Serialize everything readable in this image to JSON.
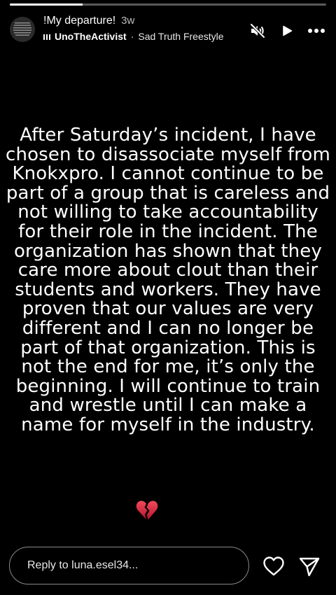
{
  "story": {
    "progress": 0.23,
    "title": "!My departure!",
    "age": "3w",
    "music": {
      "artist": "UnoTheActivist",
      "separator": "·",
      "track": "Sad Truth Freestyle"
    },
    "text_lines": [
      "After Saturday’s incident, I have",
      "chosen to disassociate myself from",
      "Knokxpro. I cannot continue to be",
      "part of a group that is careless and",
      "not willing to take accountability",
      "for their role in the incident. The",
      "organization has shown that they",
      "care more about clout than their",
      "students and workers. They have",
      "proven that our values are very",
      "different and I can no longer be",
      "part of that organization. This is",
      "not the end for me, it’s only the",
      "beginning. I will continue to train",
      "and wrestle until I can make a",
      "name for myself in the industry."
    ],
    "emoji": "broken-heart-icon"
  },
  "controls": {
    "mute_icon": "speaker-muted-icon",
    "play_icon": "play-icon",
    "more_icon": "more-horizontal-icon"
  },
  "reply": {
    "placeholder": "Reply to luna.esel34..."
  },
  "actions": {
    "like_icon": "heart-outline-icon",
    "send_icon": "paper-plane-icon"
  },
  "colors": {
    "background": "#000000",
    "text": "#ffffff",
    "muted_text": "#bdbdbd",
    "emoji_red": "#d8213a"
  }
}
